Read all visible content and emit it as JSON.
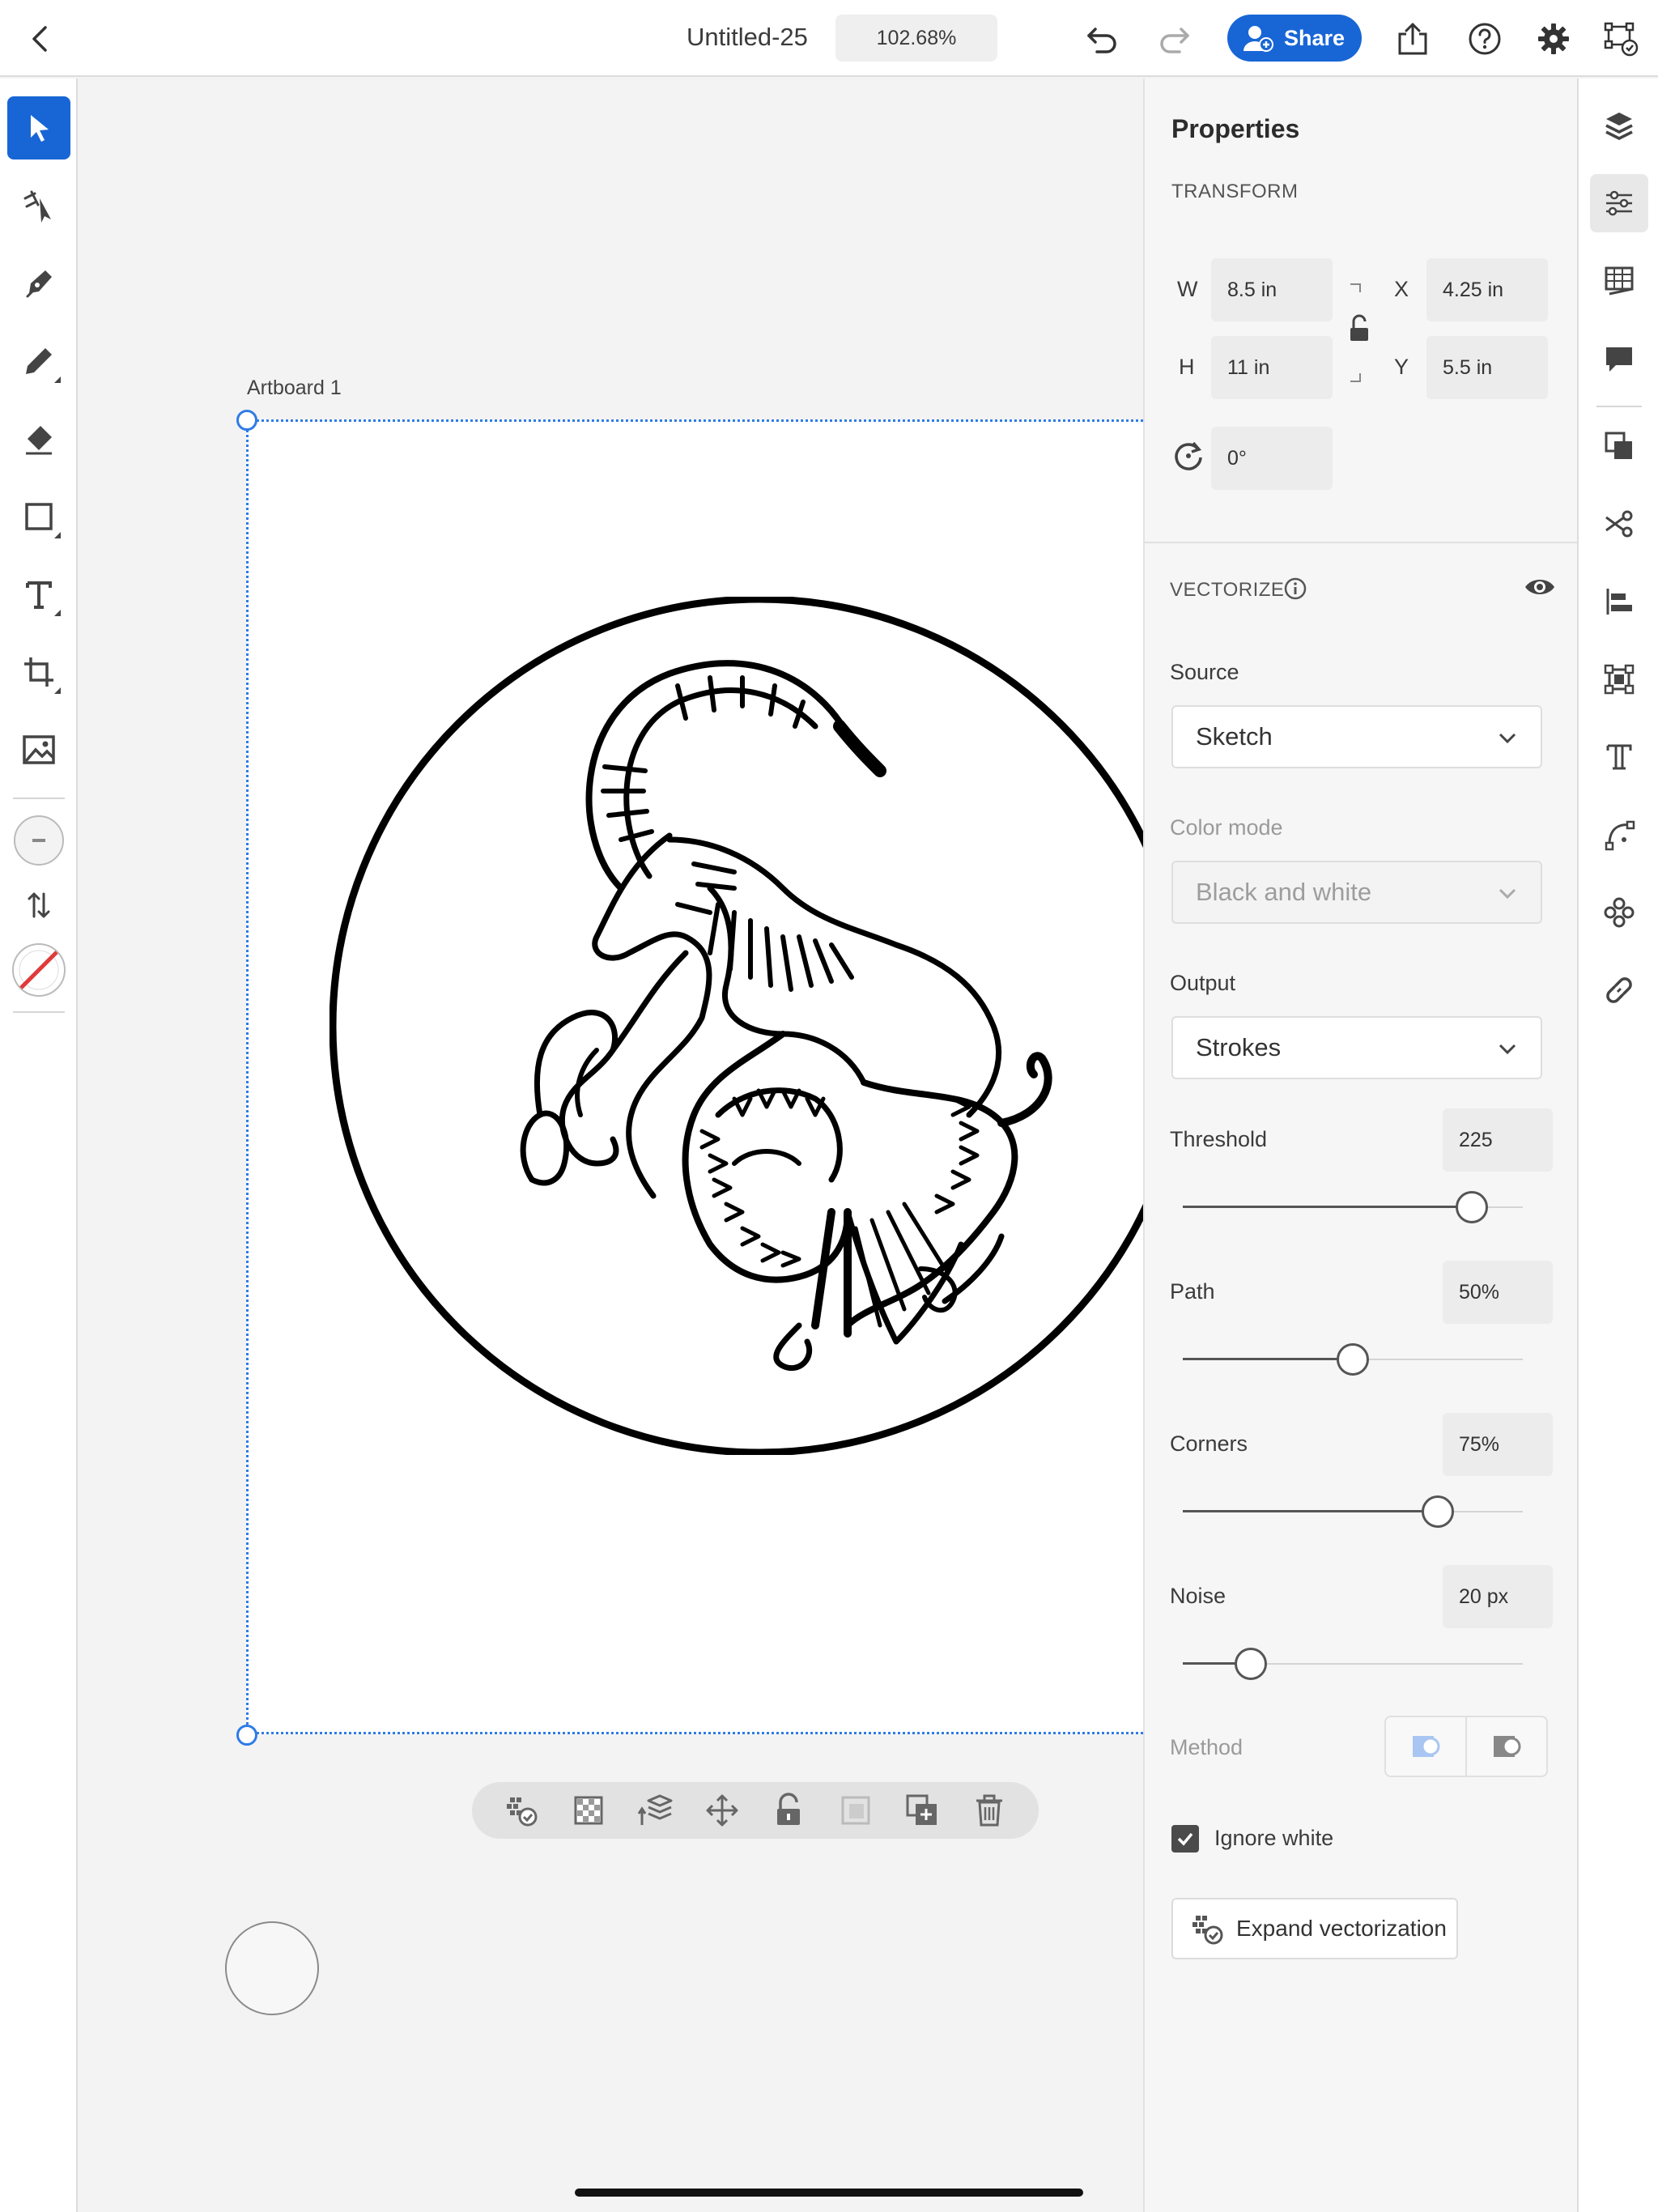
{
  "header": {
    "doc_title": "Untitled-25",
    "zoom": "102.68%",
    "share_label": "Share"
  },
  "canvas": {
    "artboard_label": "Artboard 1"
  },
  "properties": {
    "title": "Properties",
    "transform": {
      "section_label": "TRANSFORM",
      "w_label": "W",
      "w_value": "8.5 in",
      "h_label": "H",
      "h_value": "11 in",
      "x_label": "X",
      "x_value": "4.25 in",
      "y_label": "Y",
      "y_value": "5.5 in",
      "rotation_value": "0°"
    },
    "vectorize": {
      "section_label": "VECTORIZE",
      "source_label": "Source",
      "source_value": "Sketch",
      "color_mode_label": "Color mode",
      "color_mode_value": "Black and white",
      "output_label": "Output",
      "output_value": "Strokes",
      "threshold_label": "Threshold",
      "threshold_value": "225",
      "threshold_fraction": 0.85,
      "path_label": "Path",
      "path_value": "50%",
      "path_fraction": 0.5,
      "corners_label": "Corners",
      "corners_value": "75%",
      "corners_fraction": 0.75,
      "noise_label": "Noise",
      "noise_value": "20 px",
      "noise_fraction": 0.2,
      "method_label": "Method",
      "ignore_white_label": "Ignore white",
      "ignore_white_checked": true,
      "expand_label": "Expand vectorization"
    }
  },
  "colors": {
    "accent": "#1866d6",
    "selection": "#2e7be6",
    "no_fill_slash": "#e03b3b"
  },
  "icons": {
    "left_tools": [
      "select-icon",
      "lasso-icon",
      "pen-icon",
      "pencil-icon",
      "eraser-icon",
      "rectangle-icon",
      "text-icon",
      "crop-icon",
      "image-icon",
      "stroke-swatch-icon",
      "swap-icon",
      "fill-none-swatch-icon"
    ],
    "right_rail": [
      "layers-icon",
      "properties-icon",
      "libraries-icon",
      "comments-icon",
      "combine-icon",
      "scissors-icon",
      "align-icon",
      "transform-icon",
      "type-icon",
      "path-icon",
      "repeat-icon",
      "link-icon"
    ]
  }
}
